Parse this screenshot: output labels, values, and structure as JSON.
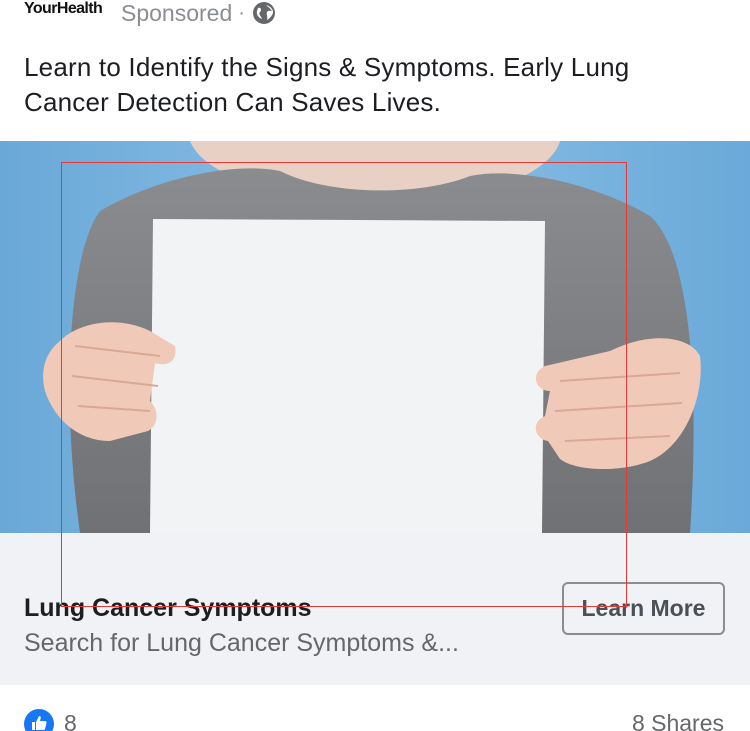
{
  "header": {
    "page_name": "YourHealth",
    "sponsored_label": "Sponsored",
    "separator": "·",
    "privacy_icon": "globe-icon"
  },
  "post": {
    "text_line1": "Learn to Identify the Signs & Symptoms. Early Lung",
    "text_line2": "Cancer Detection Can Saves Lives."
  },
  "ad_image": {
    "description_icon": "person-holding-blank-sign-image"
  },
  "link_card": {
    "title": "Lung Cancer Symptoms",
    "description": "Search for Lung Cancer Symptoms &...",
    "cta_label": "Learn More"
  },
  "footer": {
    "like_icon": "thumbs-up-icon",
    "like_count": "8",
    "shares": "8 Shares"
  },
  "colors": {
    "accent": "#1877f2",
    "annotation": "#e53935",
    "card_bg": "#f0f2f5",
    "image_bg": "#7eb6df"
  }
}
